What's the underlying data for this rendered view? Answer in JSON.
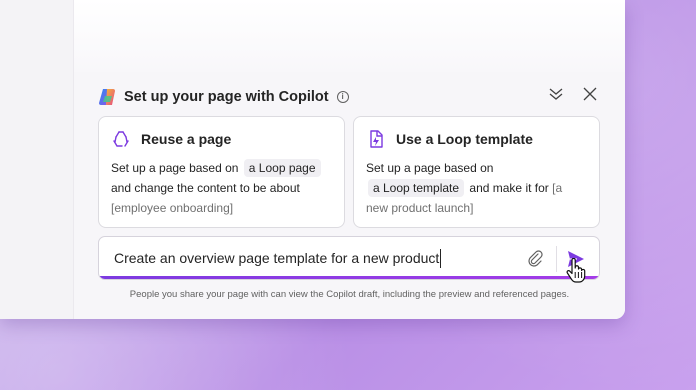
{
  "colors": {
    "accent": "#7c3ae0",
    "background": "#c3a6ea"
  },
  "panel": {
    "title": "Set up your page with Copilot",
    "info_icon": "info-icon",
    "collapse_icon": "double-chevron-down-icon",
    "close_icon": "close-icon"
  },
  "cards": [
    {
      "title": "Reuse a page",
      "icon": "recycle-icon",
      "text_1": "Set up a page based on",
      "chip": "a Loop page",
      "text_2": "and change the content to be about",
      "placeholder": "[employee onboarding]"
    },
    {
      "title": "Use a Loop template",
      "icon": "loop-template-icon",
      "text_1": "Set up a page based on",
      "chip": "a Loop template",
      "text_2": "and make it for",
      "placeholder_1": "[a",
      "placeholder_2": "new product launch]"
    }
  ],
  "prompt": {
    "value": "Create an overview page template for a new product",
    "attach_icon": "paperclip-icon",
    "send_icon": "send-icon"
  },
  "footnote": "People you share your page with can view the Copilot draft, including the preview and referenced pages."
}
